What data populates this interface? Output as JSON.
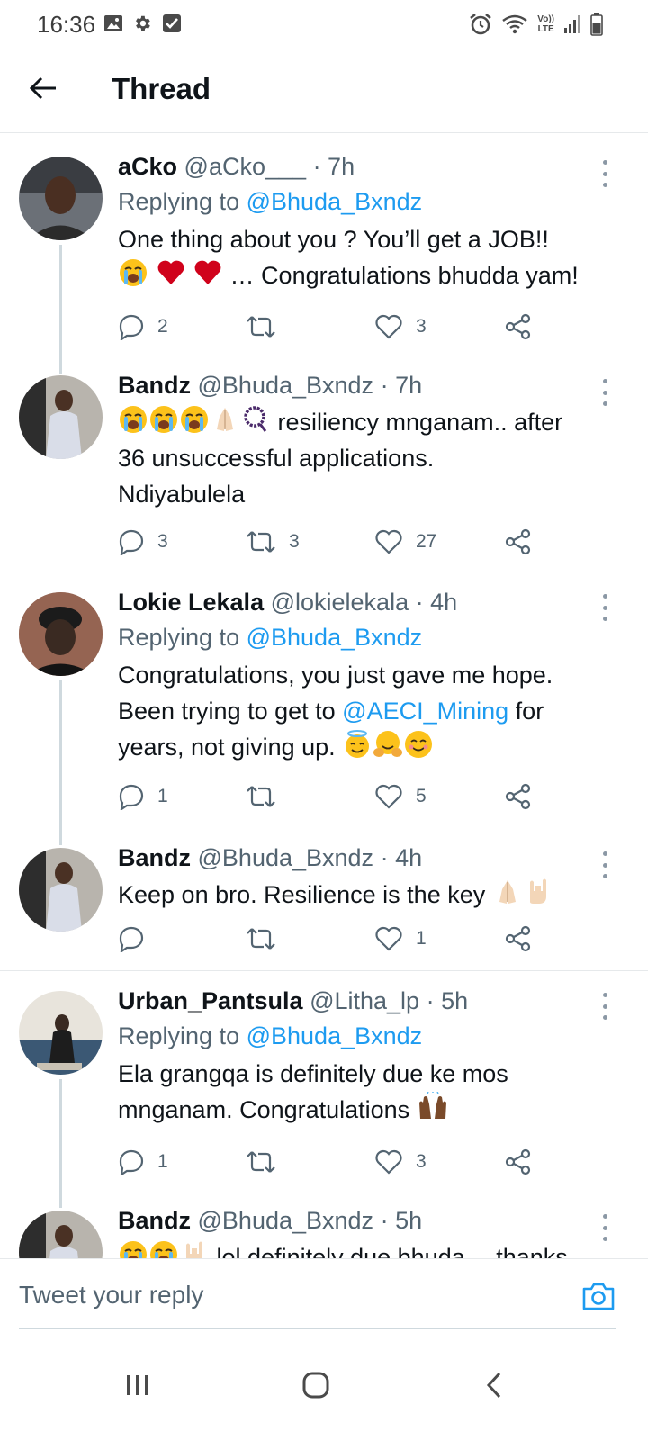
{
  "status_bar": {
    "time": "16:36",
    "icons_left": [
      "image-icon",
      "gear-icon",
      "check-box-icon"
    ],
    "icons_right": [
      "alarm-icon",
      "wifi-icon",
      "volte-icon",
      "signal-icon",
      "battery-icon"
    ],
    "volte_top": "Vo))",
    "volte_bottom": "LTE"
  },
  "header": {
    "title": "Thread"
  },
  "colors": {
    "link": "#1d9bf0",
    "heart": "#e0245e",
    "text": "#0f1419",
    "muted": "#536471"
  },
  "tweets": [
    {
      "name": "aCko",
      "handle": "@aCko___",
      "time": "· 7h",
      "replying_prefix": "Replying to",
      "replying_to": "@Bhuda_Bxndz",
      "text_1": "One thing about you ? You’ll get a JOB!!",
      "text_2": "… Congratulations bhudda yam!",
      "emojis": [
        "loudly-crying-face",
        "red-heart",
        "red-heart"
      ],
      "replies": "2",
      "retweets": "",
      "likes": "3"
    },
    {
      "name": "Bandz",
      "handle": "@Bhuda_Bxndz",
      "time": "· 7h",
      "text_1": "resiliency mnganam.. after",
      "text_2": "36 unsuccessful applications.",
      "text_3": "Ndiyabulela",
      "emojis": [
        "loudly-crying-face",
        "loudly-crying-face",
        "loudly-crying-face",
        "folded-hands",
        "prayer-beads"
      ],
      "replies": "3",
      "retweets": "3",
      "likes": "27"
    },
    {
      "name": "Lokie Lekala",
      "handle": "@lokielekala",
      "time": "· 4h",
      "replying_prefix": "Replying to",
      "replying_to": "@Bhuda_Bxndz",
      "text_1": "Congratulations, you just gave me hope.",
      "text_2a": "Been trying to get to",
      "mention": "@AECI_Mining",
      "text_2b": "for",
      "text_3": "years, not giving up.",
      "emojis": [
        "smiling-face-with-halo",
        "hugging-face",
        "smiling-face-with-smiling-eyes"
      ],
      "replies": "1",
      "retweets": "",
      "likes": "5"
    },
    {
      "name": "Bandz",
      "handle": "@Bhuda_Bxndz",
      "time": "· 4h",
      "text_1": "Keep on bro. Resilience is the key",
      "emojis": [
        "folded-hands",
        "love-you-gesture"
      ],
      "replies": "",
      "retweets": "",
      "likes": "1"
    },
    {
      "name": "Urban_Pantsula",
      "handle": "@Litha_lp",
      "time": "· 5h",
      "replying_prefix": "Replying to",
      "replying_to": "@Bhuda_Bxndz",
      "text_1": "Ela grangqa is definitely due ke mos",
      "text_2": "mnganam. Congratulations",
      "emojis": [
        "raising-hands"
      ],
      "replies": "1",
      "retweets": "",
      "likes": "3"
    },
    {
      "name": "Bandz",
      "handle": "@Bhuda_Bxndz",
      "time": "· 5h",
      "text_1": "lol definitely due bhuda… thanks",
      "emojis": [
        "loudly-crying-face",
        "loudly-crying-face",
        "love-you-gesture"
      ]
    }
  ],
  "reply_box": {
    "placeholder": "Tweet your reply"
  },
  "nav_bar": {
    "buttons": [
      "recent-apps-icon",
      "home-icon",
      "back-icon"
    ]
  }
}
